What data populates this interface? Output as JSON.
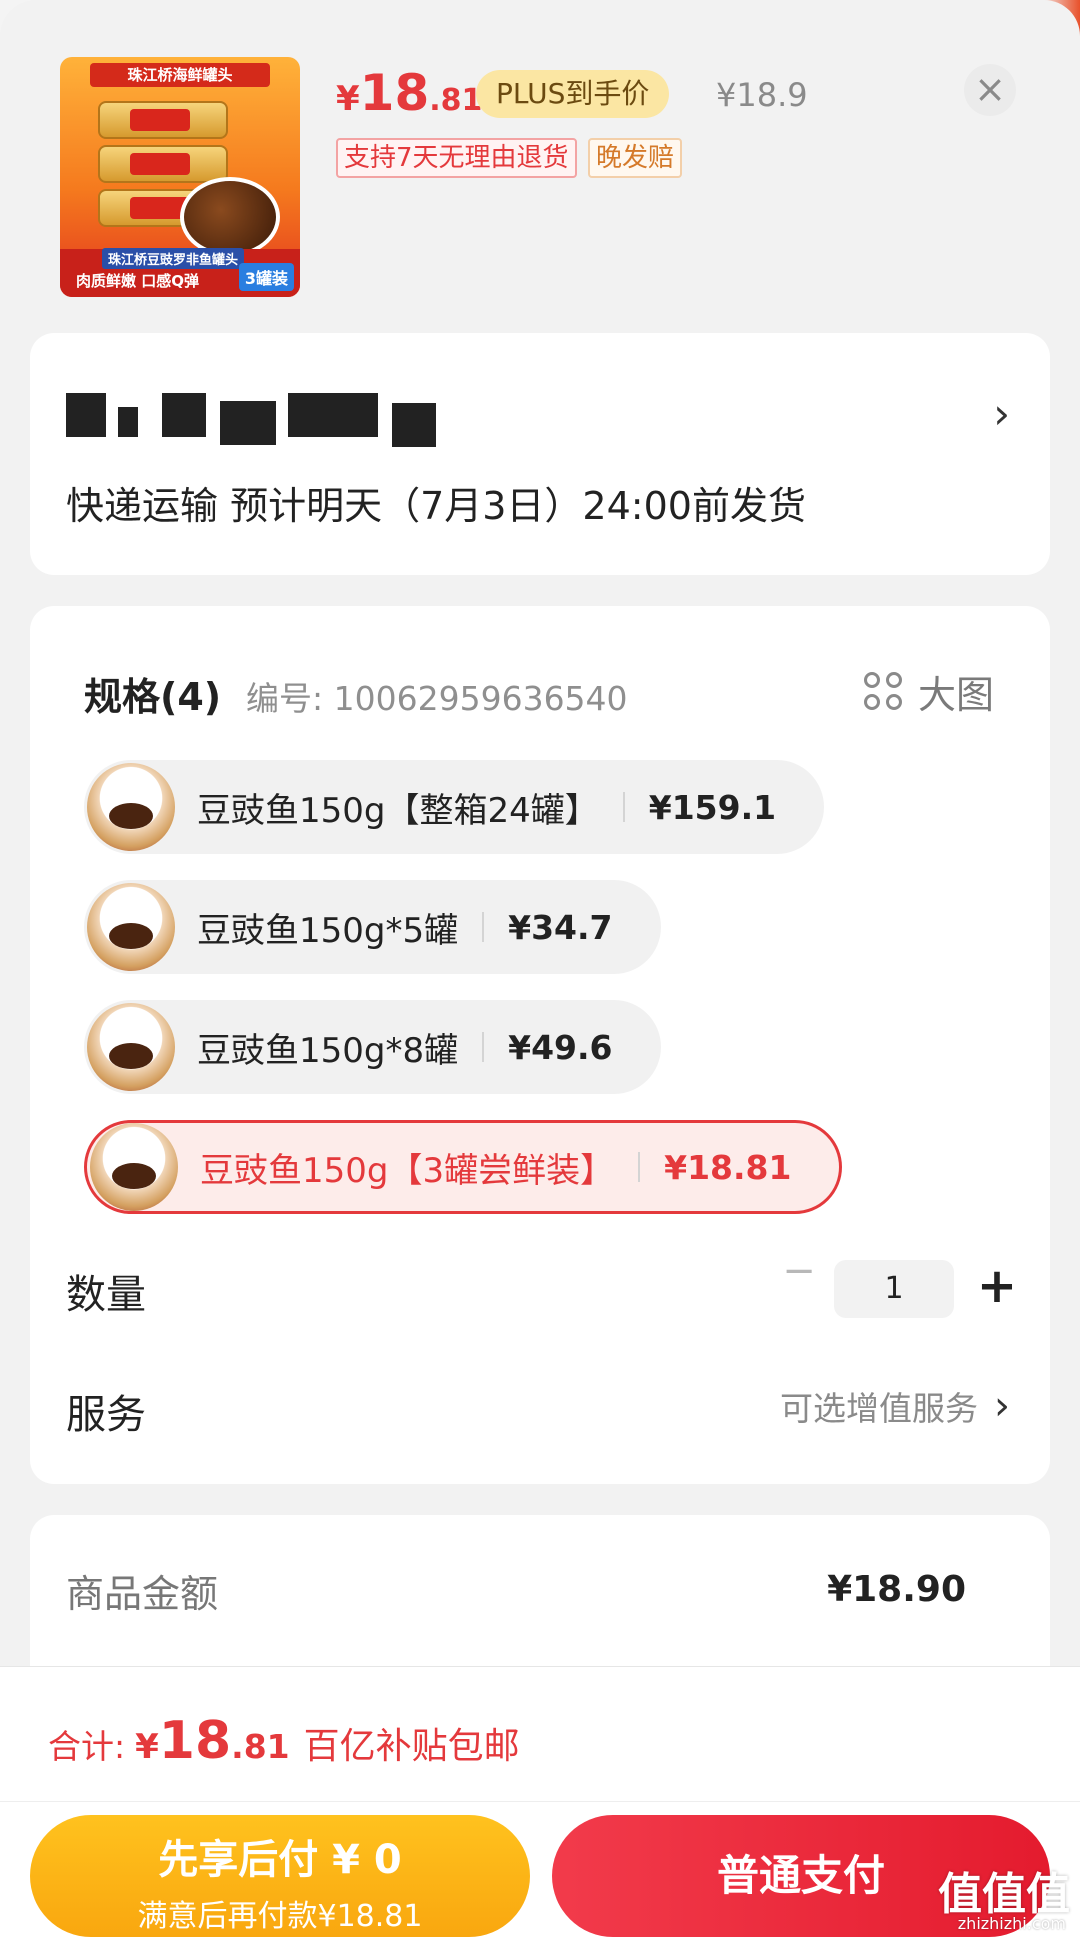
{
  "product": {
    "price_currency": "¥",
    "price_int": "18",
    "price_dec": ".81",
    "plus_tag": "PLUS到手价",
    "original_price": "¥18.9",
    "close_icon": "close-icon",
    "tags": [
      "支持7天无理由退货",
      "晚发赔"
    ],
    "thumb_texts": {
      "top": "珠江桥海鲜罐头",
      "band": "珠江桥豆豉罗非鱼罐头",
      "bottom": "肉质鲜嫩 口感Q弹",
      "badge": "3罐装"
    }
  },
  "address": {
    "ship_text": "快递运输 预计明天（7月3日）24:00前发货",
    "arrow": "›"
  },
  "spec": {
    "title": "规格(4)",
    "code": "编号: 10062959636540",
    "bigpic_label": "大图",
    "options": [
      {
        "name": "豆豉鱼150g【整箱24罐】",
        "price": "¥159.1",
        "selected": false
      },
      {
        "name": "豆豉鱼150g*5罐",
        "price": "¥34.7",
        "selected": false
      },
      {
        "name": "豆豉鱼150g*8罐",
        "price": "¥49.6",
        "selected": false
      },
      {
        "name": "豆豉鱼150g【3罐尝鲜装】",
        "price": "¥18.81",
        "selected": true
      }
    ],
    "quantity_label": "数量",
    "quantity_value": "1",
    "minus": "−",
    "plus": "+",
    "service_label": "服务",
    "service_value": "可选增值服务",
    "service_arrow": "›"
  },
  "summary": {
    "goods_amount_label": "商品金额",
    "goods_amount_value": "¥18.90"
  },
  "footer": {
    "total_label": "合计:",
    "total_currency": "¥",
    "total_int": "18",
    "total_dec": ".81",
    "total_note": "百亿补贴包邮",
    "later_line1": "先享后付 ¥ 0",
    "later_line2": "满意后再付款¥18.81",
    "pay_label": "普通支付"
  },
  "watermark": {
    "text": "值值值",
    "url": "zhizhizhi.com"
  },
  "colors": {
    "accent": "#e4393c",
    "plus_bg": "#fbe6a3",
    "later_btn": "#ffc21e",
    "pay_btn": "#e41b2e"
  }
}
